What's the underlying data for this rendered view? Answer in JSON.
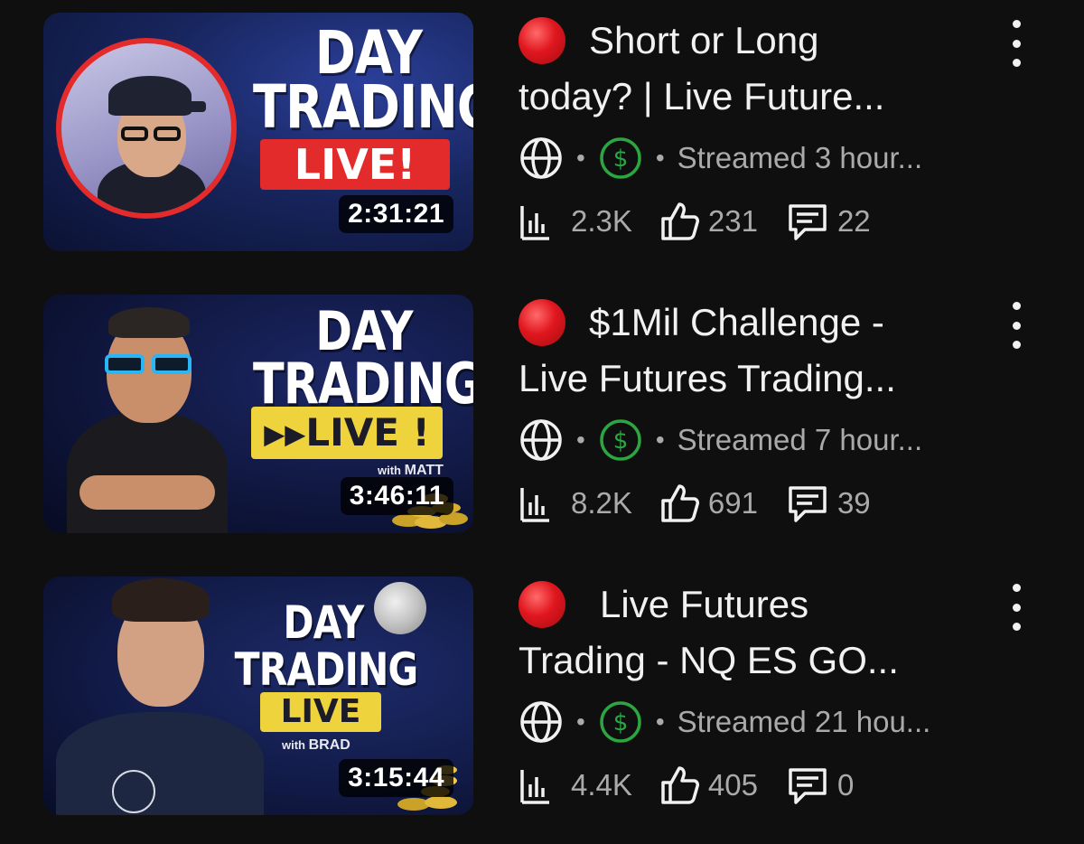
{
  "videos": [
    {
      "title_line1": "Short or Long",
      "title_line2": "today? | Live Future...",
      "thumb": {
        "title1": "DAY",
        "title2": "TRADING",
        "badge": "LIVE!",
        "host_prefix": "",
        "host": ""
      },
      "duration": "2:31:21",
      "meta_text": "Streamed 3 hour...",
      "views": "2.3K",
      "likes": "231",
      "comments": "22"
    },
    {
      "title_line1": "$1Mil Challenge -",
      "title_line2": "Live Futures Trading...",
      "thumb": {
        "title1": "DAY",
        "title2": "TRADING",
        "badge": "LIVE !",
        "host_prefix": "with",
        "host": "MATT"
      },
      "duration": "3:46:11",
      "meta_text": "Streamed 7 hour...",
      "views": "8.2K",
      "likes": "691",
      "comments": "39"
    },
    {
      "title_line1": "Live Futures",
      "title_line2": "Trading - NQ ES GO...",
      "thumb": {
        "title1": "DAY",
        "title2": "TRADING",
        "badge": "LIVE",
        "host_prefix": "with",
        "host": "BRAD"
      },
      "duration": "3:15:44",
      "meta_text": "Streamed 21 hou...",
      "views": "4.4K",
      "likes": "405",
      "comments": "0"
    }
  ],
  "icons": {
    "live": "red-circle-icon",
    "visibility": "globe-icon",
    "monetization": "dollar-icon",
    "views": "bar-chart-icon",
    "likes": "thumbs-up-icon",
    "comments": "comment-icon",
    "more": "more-vertical-icon"
  },
  "colors": {
    "background": "#0f0f0f",
    "live_red": "#e0161e",
    "monetization_green": "#2ba640",
    "secondary_text": "#aaaaaa"
  }
}
